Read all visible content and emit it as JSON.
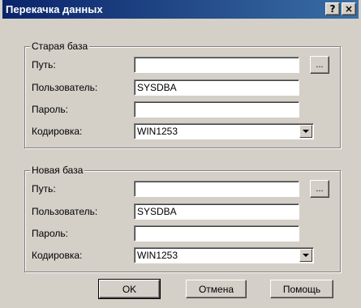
{
  "window": {
    "title": "Перекачка данных",
    "help_button": "?",
    "close_button": "×"
  },
  "old_db": {
    "legend": "Старая база",
    "path_label": "Путь:",
    "path_value": "",
    "browse_label": "...",
    "user_label": "Пользователь:",
    "user_value": "SYSDBA",
    "password_label": "Пароль:",
    "password_value": "",
    "encoding_label": "Кодировка:",
    "encoding_value": "WIN1253"
  },
  "new_db": {
    "legend": "Новая база",
    "path_label": "Путь:",
    "path_value": "",
    "browse_label": "...",
    "user_label": "Пользователь:",
    "user_value": "SYSDBA",
    "password_label": "Пароль:",
    "password_value": "",
    "encoding_label": "Кодировка:",
    "encoding_value": "WIN1253"
  },
  "buttons": {
    "ok": "OK",
    "cancel": "Отмена",
    "help": "Помощь"
  },
  "colors": {
    "title_bar": "#0a246a",
    "face": "#d4d0c8"
  }
}
